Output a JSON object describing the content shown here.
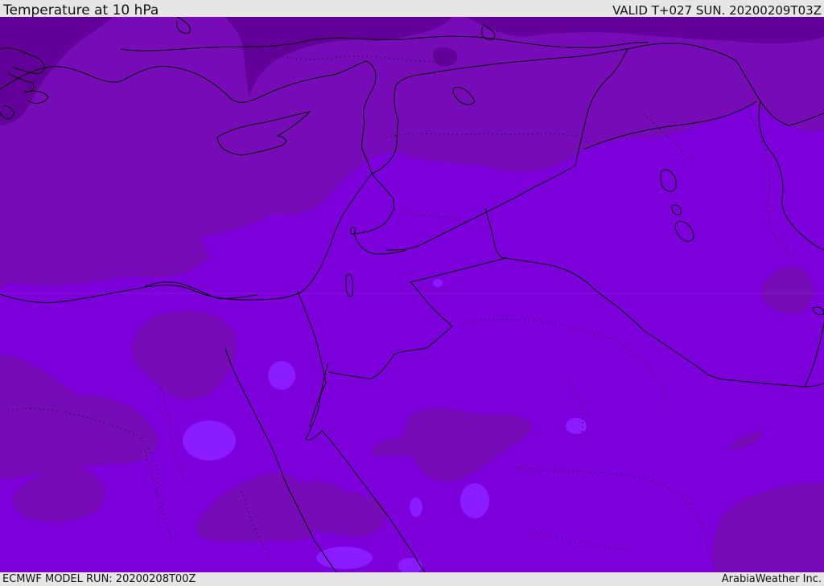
{
  "header": {
    "title": "Temperature at 10 hPa",
    "valid_time": "VALID T+027 SUN. 20200209T03Z"
  },
  "footer": {
    "model_run": "ECMWF MODEL RUN: 20200208T00Z",
    "credit": "ArabiaWeather Inc."
  },
  "colors": {
    "background": "#e6e6e6",
    "field_base": "#7d00dc",
    "field_cooler": "#760bb7",
    "field_coldest": "#64009a",
    "field_warmer": "#8a1cff",
    "coastline": "#000000"
  },
  "map_features": [
    "coastline-mediterranean",
    "coastline-red-sea",
    "country-borders",
    "cyprus-island",
    "sea-of-galilee",
    "dead-sea",
    "arabian-gulf-islands"
  ]
}
